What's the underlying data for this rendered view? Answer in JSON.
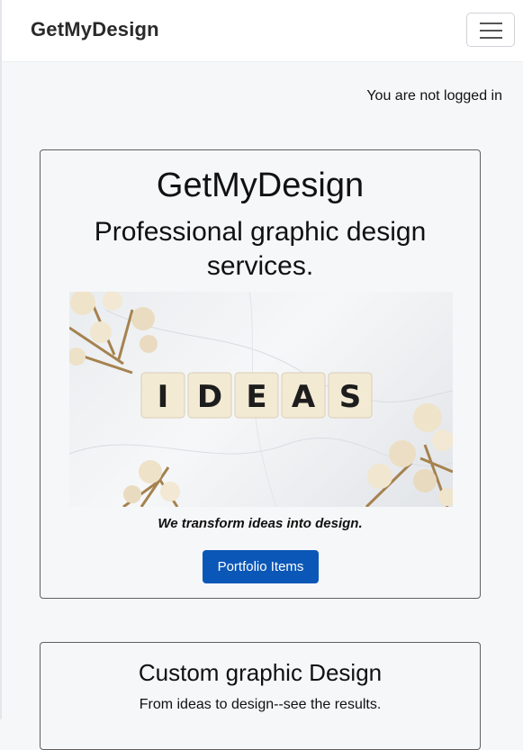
{
  "navbar": {
    "brand": "GetMyDesign",
    "menu_icon": "hamburger-menu-icon"
  },
  "login_status": "You are not logged in",
  "hero": {
    "title": "GetMyDesign",
    "subtitle": "Professional graphic design services.",
    "image_tiles": [
      "I",
      "D",
      "E",
      "A",
      "S"
    ],
    "tagline": "We transform ideas into design.",
    "button_label": "Portfolio Items"
  },
  "services": {
    "title": "Custom graphic Design",
    "description": "From ideas to design--see the results."
  },
  "colors": {
    "primary_button": "#0b57b7",
    "page_background": "#f6f7f9",
    "navbar_background": "#ffffff"
  }
}
